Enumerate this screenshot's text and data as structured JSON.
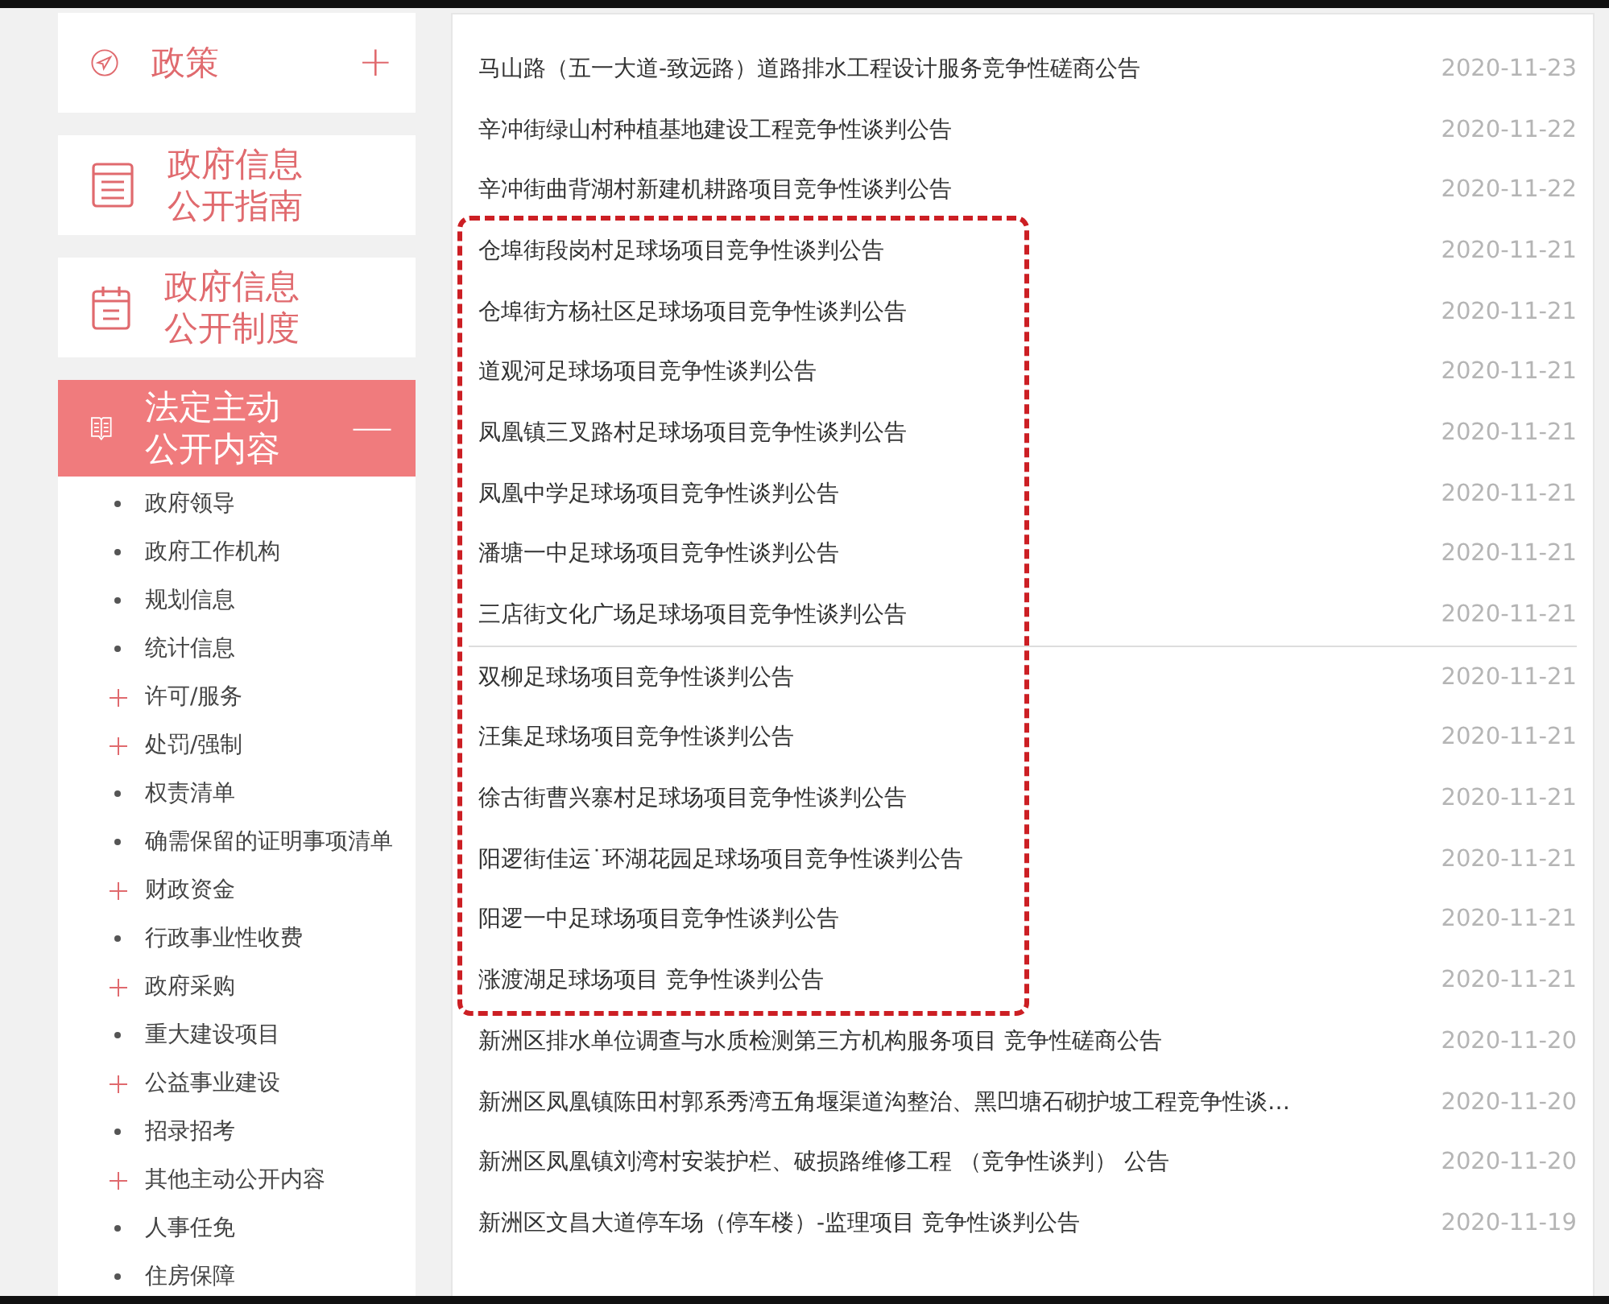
{
  "sidebar": {
    "menus": [
      {
        "label": "政策",
        "toggle": "+",
        "active": false
      },
      {
        "label": "政府信息公开指南",
        "active": false
      },
      {
        "label": "政府信息公开制度",
        "active": false
      },
      {
        "label": "法定主动公开内容",
        "toggle": "—",
        "active": true,
        "expanded": true,
        "children": [
          {
            "label": "政府领导",
            "kind": "leaf"
          },
          {
            "label": "政府工作机构",
            "kind": "leaf"
          },
          {
            "label": "规划信息",
            "kind": "leaf"
          },
          {
            "label": "统计信息",
            "kind": "leaf"
          },
          {
            "label": "许可/服务",
            "kind": "group"
          },
          {
            "label": "处罚/强制",
            "kind": "group"
          },
          {
            "label": "权责清单",
            "kind": "leaf"
          },
          {
            "label": "确需保留的证明事项清单",
            "kind": "leaf"
          },
          {
            "label": "财政资金",
            "kind": "group"
          },
          {
            "label": "行政事业性收费",
            "kind": "leaf"
          },
          {
            "label": "政府采购",
            "kind": "group"
          },
          {
            "label": "重大建设项目",
            "kind": "leaf"
          },
          {
            "label": "公益事业建设",
            "kind": "group"
          },
          {
            "label": "招录招考",
            "kind": "leaf"
          },
          {
            "label": "其他主动公开内容",
            "kind": "group"
          },
          {
            "label": "人事任免",
            "kind": "leaf"
          },
          {
            "label": "住房保障",
            "kind": "leaf"
          }
        ]
      }
    ]
  },
  "notice_blocks": [
    {
      "highlighted": false,
      "sections": [
        {
          "rows": [
            {
              "title": "马山路（五一大道-致远路）道路排水工程设计服务竞争性磋商公告",
              "date": "2020-11-23"
            },
            {
              "title": "辛冲街绿山村种植基地建设工程竞争性谈判公告",
              "date": "2020-11-22"
            },
            {
              "title": "辛冲街曲背湖村新建机耕路项目竞争性谈判公告",
              "date": "2020-11-22"
            }
          ]
        }
      ]
    },
    {
      "highlighted": true,
      "sections": [
        {
          "rows": [
            {
              "title": "仓埠街段岗村足球场项目竞争性谈判公告",
              "date": "2020-11-21"
            },
            {
              "title": "仓埠街方杨社区足球场项目竞争性谈判公告",
              "date": "2020-11-21"
            },
            {
              "title": "道观河足球场项目竞争性谈判公告",
              "date": "2020-11-21"
            },
            {
              "title": "凤凰镇三叉路村足球场项目竞争性谈判公告",
              "date": "2020-11-21"
            },
            {
              "title": "凤凰中学足球场项目竞争性谈判公告",
              "date": "2020-11-21"
            },
            {
              "title": "潘塘一中足球场项目竞争性谈判公告",
              "date": "2020-11-21"
            },
            {
              "title": "三店街文化广场足球场项目竞争性谈判公告",
              "date": "2020-11-21"
            }
          ]
        },
        {
          "rows": [
            {
              "title": "双柳足球场项目竞争性谈判公告",
              "date": "2020-11-21"
            },
            {
              "title": "汪集足球场项目竞争性谈判公告",
              "date": "2020-11-21"
            },
            {
              "title": "徐古街曹兴寨村足球场项目竞争性谈判公告",
              "date": "2020-11-21"
            },
            {
              "title": "阳逻街佳运˙环湖花园足球场项目竞争性谈判公告",
              "date": "2020-11-21"
            },
            {
              "title": "阳逻一中足球场项目竞争性谈判公告",
              "date": "2020-11-21"
            },
            {
              "title": "涨渡湖足球场项目 竞争性谈判公告",
              "date": "2020-11-21"
            }
          ]
        }
      ]
    },
    {
      "highlighted": false,
      "sections": [
        {
          "rows": [
            {
              "title": "新洲区排水单位调查与水质检测第三方机构服务项目 竞争性磋商公告",
              "date": "2020-11-20"
            },
            {
              "title": "新洲区凤凰镇陈田村郭系秀湾五角堰渠道沟整治、黑凹塘石砌护坡工程竞争性谈…",
              "date": "2020-11-20"
            },
            {
              "title": "新洲区凤凰镇刘湾村安装护栏、破损路维修工程 （竞争性谈判） 公告",
              "date": "2020-11-20"
            },
            {
              "title": "新洲区文昌大道停车场（停车楼）-监理项目 竞争性谈判公告",
              "date": "2020-11-19"
            }
          ]
        }
      ]
    }
  ]
}
